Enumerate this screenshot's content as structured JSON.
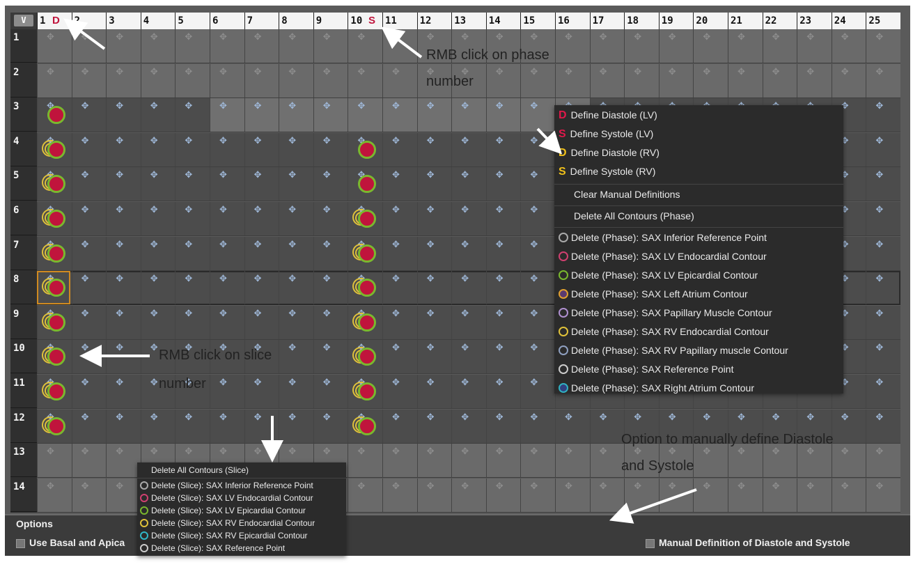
{
  "view_button": "V",
  "phases": [
    "1",
    "2",
    "3",
    "4",
    "5",
    "6",
    "7",
    "8",
    "9",
    "10",
    "11",
    "12",
    "13",
    "14",
    "15",
    "16",
    "17",
    "18",
    "19",
    "20",
    "21",
    "22",
    "23",
    "24",
    "25"
  ],
  "slices": [
    "1",
    "2",
    "3",
    "4",
    "5",
    "6",
    "7",
    "8",
    "9",
    "10",
    "11",
    "12",
    "13",
    "14"
  ],
  "phase_markers": {
    "phase1": "D",
    "phase10": "S"
  },
  "phase_menu": {
    "items": [
      {
        "label": "Define Diastole (LV)",
        "icon": "D",
        "color": "#e0184a"
      },
      {
        "label": "Define Systole (LV)",
        "icon": "S",
        "color": "#e0184a"
      },
      {
        "label": "Define Diastole (RV)",
        "icon": "D",
        "color": "#f2c21a"
      },
      {
        "label": "Define Systole (RV)",
        "icon": "S",
        "color": "#f2c21a"
      }
    ],
    "clear_label": "Clear Manual Definitions",
    "delete_all_label": "Delete All Contours (Phase)",
    "delete_items": [
      {
        "label": "Delete (Phase): SAX Inferior Reference Point",
        "icon": "inferior-ref-icon"
      },
      {
        "label": "Delete (Phase): SAX LV Endocardial Contour",
        "icon": "lv-endo-icon"
      },
      {
        "label": "Delete (Phase): SAX LV Epicardial Contour",
        "icon": "lv-epi-icon"
      },
      {
        "label": "Delete (Phase): SAX Left Atrium Contour",
        "icon": "left-atrium-icon"
      },
      {
        "label": "Delete (Phase): SAX Papillary Muscle Contour",
        "icon": "papillary-icon"
      },
      {
        "label": "Delete (Phase): SAX RV Endocardial Contour",
        "icon": "rv-endo-icon"
      },
      {
        "label": "Delete (Phase): SAX RV Papillary muscle Contour",
        "icon": "rv-papillary-icon"
      },
      {
        "label": "Delete (Phase): SAX Reference Point",
        "icon": "reference-point-icon"
      },
      {
        "label": "Delete (Phase): SAX Right Atrium Contour",
        "icon": "right-atrium-icon"
      }
    ]
  },
  "slice_menu": {
    "delete_all_label": "Delete All Contours (Slice)",
    "delete_items": [
      {
        "label": "Delete (Slice): SAX Inferior Reference Point",
        "icon": "inferior-ref-icon"
      },
      {
        "label": "Delete (Slice): SAX LV Endocardial Contour",
        "icon": "lv-endo-icon"
      },
      {
        "label": "Delete (Slice): SAX LV Epicardial Contour",
        "icon": "lv-epi-icon"
      },
      {
        "label": "Delete (Slice): SAX RV Endocardial Contour",
        "icon": "rv-endo-icon"
      },
      {
        "label": "Delete (Slice): SAX RV Epicardial Contour",
        "icon": "rv-epi-icon"
      },
      {
        "label": "Delete (Slice): SAX Reference Point",
        "icon": "reference-point-icon"
      }
    ]
  },
  "options": {
    "title": "Options",
    "basal_apical_label": "Use Basal and Apica",
    "manual_definition_label": "Manual Definition of Diastole and Systole"
  },
  "annotations": {
    "phase_click_line1": "RMB click on phase",
    "phase_click_line2": "number",
    "slice_click_line1": "RMB click on slice",
    "slice_click_line2": "number",
    "option_line1": "Option to manually define Diastole",
    "option_line2": "and Systole"
  },
  "colors": {
    "lv_red": "#c0143c",
    "epi_green": "#7ab82e",
    "rv_yellow": "#e0c23a",
    "selection_orange": "#d08a20"
  }
}
